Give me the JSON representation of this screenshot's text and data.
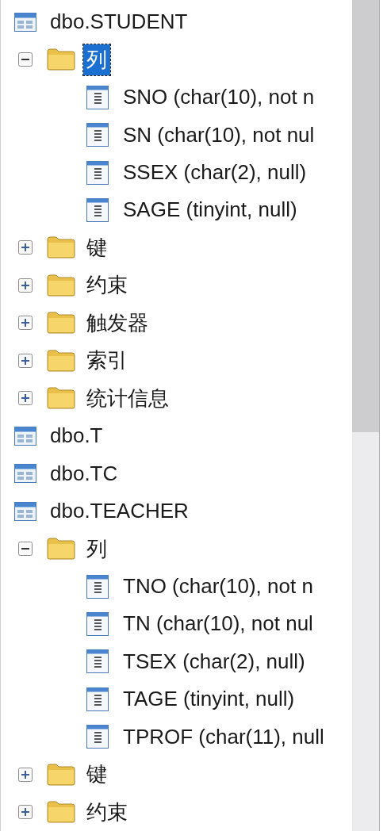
{
  "tree": [
    {
      "label": "dbo.STUDENT",
      "kind": "table",
      "selected": false,
      "children": [
        {
          "label": "列",
          "kind": "folder",
          "expanded": true,
          "selected": true,
          "children": [
            {
              "label": "SNO (char(10), not n",
              "kind": "column",
              "selected": false
            },
            {
              "label": "SN (char(10), not nul",
              "kind": "column",
              "selected": false
            },
            {
              "label": "SSEX (char(2), null)",
              "kind": "column",
              "selected": false
            },
            {
              "label": "SAGE (tinyint, null)",
              "kind": "column",
              "selected": false
            }
          ]
        },
        {
          "label": "键",
          "kind": "folder",
          "expanded": false,
          "selected": false
        },
        {
          "label": "约束",
          "kind": "folder",
          "expanded": false,
          "selected": false
        },
        {
          "label": "触发器",
          "kind": "folder",
          "expanded": false,
          "selected": false
        },
        {
          "label": "索引",
          "kind": "folder",
          "expanded": false,
          "selected": false
        },
        {
          "label": "统计信息",
          "kind": "folder",
          "expanded": false,
          "selected": false
        }
      ]
    },
    {
      "label": "dbo.T",
      "kind": "table",
      "selected": false
    },
    {
      "label": "dbo.TC",
      "kind": "table",
      "selected": false
    },
    {
      "label": "dbo.TEACHER",
      "kind": "table",
      "selected": false,
      "children": [
        {
          "label": "列",
          "kind": "folder",
          "expanded": true,
          "selected": false,
          "children": [
            {
              "label": "TNO (char(10), not n",
              "kind": "column",
              "selected": false
            },
            {
              "label": "TN (char(10), not nul",
              "kind": "column",
              "selected": false
            },
            {
              "label": "TSEX (char(2), null)",
              "kind": "column",
              "selected": false
            },
            {
              "label": "TAGE (tinyint, null)",
              "kind": "column",
              "selected": false
            },
            {
              "label": "TPROF (char(11), null",
              "kind": "column",
              "selected": false
            }
          ]
        },
        {
          "label": "键",
          "kind": "folder",
          "expanded": false,
          "selected": false
        },
        {
          "label": "约束",
          "kind": "folder",
          "expanded": false,
          "selected": false
        }
      ]
    }
  ]
}
